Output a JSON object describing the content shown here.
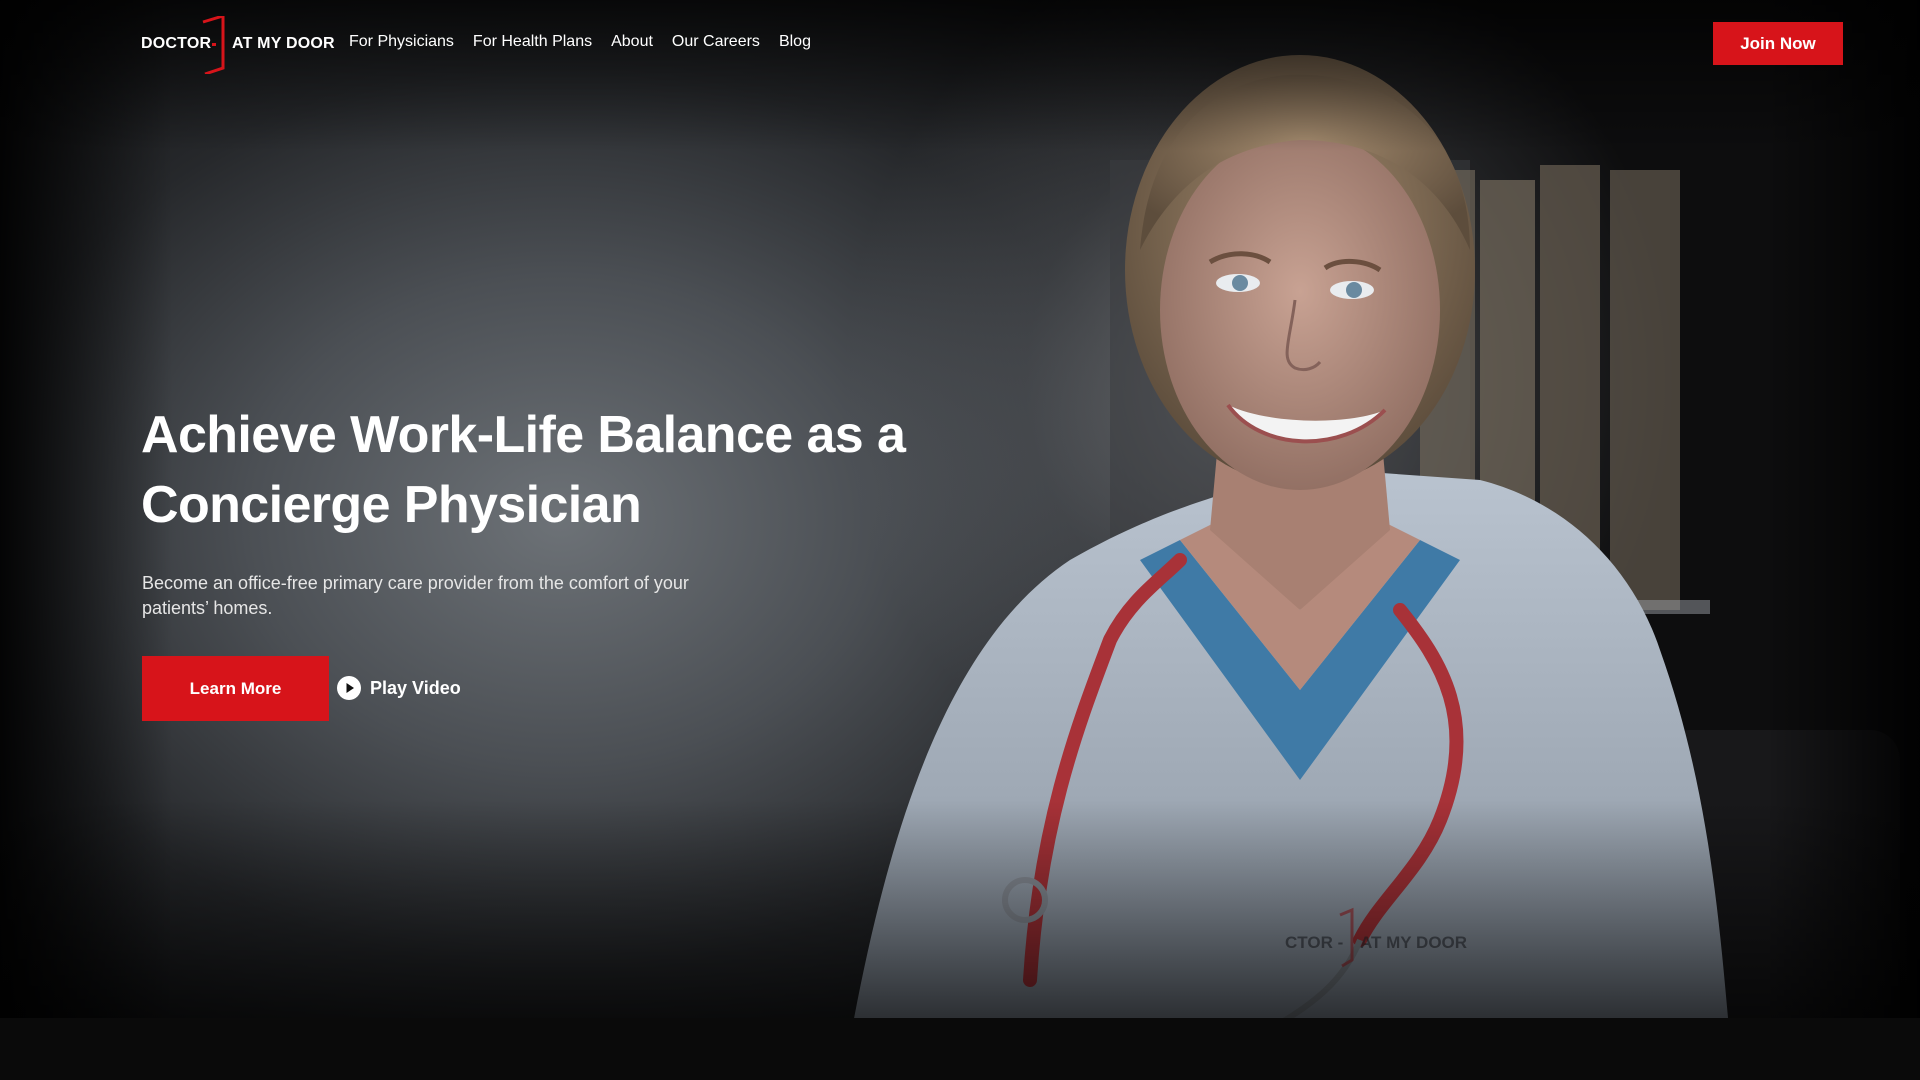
{
  "brand": {
    "name_left": "DOCTOR",
    "name_right": "AT MY DOOR",
    "accent_color": "#d7141a"
  },
  "nav": {
    "links": [
      "For Physicians",
      "For Health Plans",
      "About",
      "Our Careers",
      "Blog"
    ],
    "cta": "Join Now"
  },
  "hero": {
    "headline": "Achieve Work-Life Balance as a Concierge Physician",
    "subtext": "Become an office-free primary care provider from the comfort of your patients’ homes.",
    "primary_button": "Learn More",
    "video_button": "Play Video",
    "image_description_icon": "doctor-portrait-image"
  }
}
